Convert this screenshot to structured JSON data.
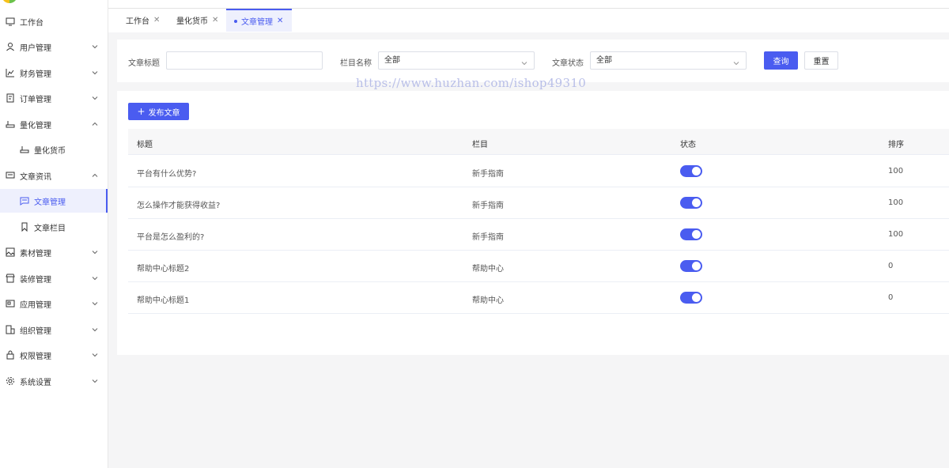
{
  "sidebar": {
    "items": [
      {
        "label": "工作台"
      },
      {
        "label": "用户管理"
      },
      {
        "label": "财务管理"
      },
      {
        "label": "订单管理"
      },
      {
        "label": "量化管理"
      },
      {
        "label": "量化货币"
      },
      {
        "label": "文章资讯"
      },
      {
        "label": "文章管理"
      },
      {
        "label": "文章栏目"
      },
      {
        "label": "素材管理"
      },
      {
        "label": "装修管理"
      },
      {
        "label": "应用管理"
      },
      {
        "label": "组织管理"
      },
      {
        "label": "权限管理"
      },
      {
        "label": "系统设置"
      }
    ]
  },
  "tabs": [
    {
      "label": "工作台"
    },
    {
      "label": "量化货币"
    },
    {
      "label": "文章管理"
    }
  ],
  "filter": {
    "title_label": "文章标题",
    "title_value": "",
    "category_label": "栏目名称",
    "category_value": "全部",
    "status_label": "文章状态",
    "status_value": "全部",
    "search_button": "查询",
    "reset_button": "重置"
  },
  "watermark": "https://www.huzhan.com/ishop49310",
  "table": {
    "add_button": "发布文章",
    "columns": [
      "标题",
      "栏目",
      "状态",
      "排序"
    ],
    "rows": [
      {
        "title": "平台有什么优势?",
        "category": "新手指南",
        "status_on": true,
        "sort": "100"
      },
      {
        "title": "怎么操作才能获得收益?",
        "category": "新手指南",
        "status_on": true,
        "sort": "100"
      },
      {
        "title": "平台是怎么盈利的?",
        "category": "新手指南",
        "status_on": true,
        "sort": "100"
      },
      {
        "title": "帮助中心标题2",
        "category": "帮助中心",
        "status_on": true,
        "sort": "0"
      },
      {
        "title": "帮助中心标题1",
        "category": "帮助中心",
        "status_on": true,
        "sort": "0"
      }
    ]
  },
  "colors": {
    "accent": "#4a5cf0",
    "page_bg": "#f5f5f6"
  }
}
